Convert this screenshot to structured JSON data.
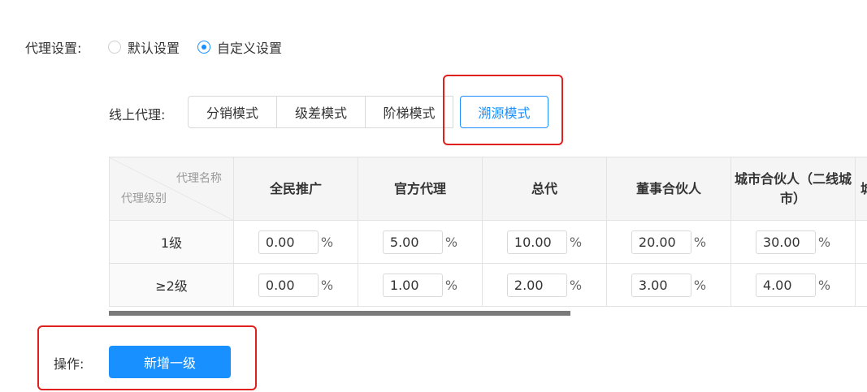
{
  "agent_settings": {
    "label": "代理设置:",
    "options": [
      {
        "label": "默认设置",
        "checked": false
      },
      {
        "label": "自定义设置",
        "checked": true
      }
    ]
  },
  "online_agent": {
    "label": "线上代理:",
    "modes": [
      "分销模式",
      "级差模式",
      "阶梯模式",
      "溯源模式"
    ],
    "active_mode": "溯源模式"
  },
  "table": {
    "corner_top": "代理名称",
    "corner_bottom": "代理级别",
    "columns": [
      "全民推广",
      "官方代理",
      "总代",
      "董事合伙人",
      "城市合伙人（二线城市）",
      "城"
    ],
    "rows": [
      {
        "level": "1级",
        "values": [
          "0.00",
          "5.00",
          "10.00",
          "20.00",
          "30.00"
        ]
      },
      {
        "level": "≥2级",
        "values": [
          "0.00",
          "1.00",
          "2.00",
          "3.00",
          "4.00"
        ]
      }
    ],
    "unit": "%"
  },
  "operation": {
    "label": "操作:",
    "add_level_button": "新增一级"
  },
  "colors": {
    "primary": "#1890ff",
    "highlight_box": "#e0201c"
  }
}
